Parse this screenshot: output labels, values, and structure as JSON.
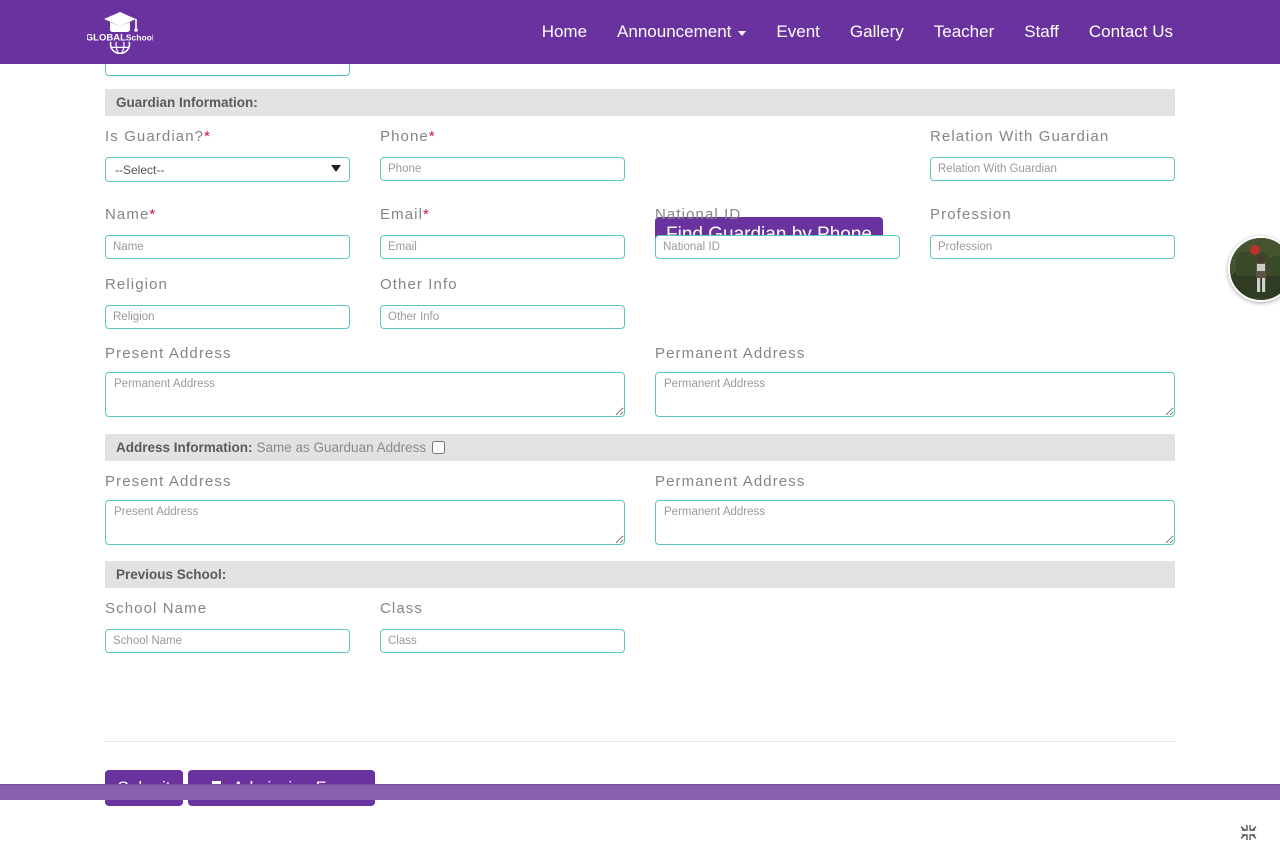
{
  "header": {
    "logo": {
      "icon": "graduation-cap-globe-logo",
      "text_primary": "GLOBAL",
      "text_secondary": "School"
    },
    "nav": [
      {
        "label": "Home",
        "has_dropdown": false
      },
      {
        "label": "Announcement",
        "has_dropdown": true
      },
      {
        "label": "Event",
        "has_dropdown": false
      },
      {
        "label": "Gallery",
        "has_dropdown": false
      },
      {
        "label": "Teacher",
        "has_dropdown": false
      },
      {
        "label": "Staff",
        "has_dropdown": false
      },
      {
        "label": "Contact Us",
        "has_dropdown": false
      }
    ],
    "background_color": "#6a329f"
  },
  "sections": {
    "guardian": {
      "title": "Guardian Information:"
    },
    "address": {
      "title": "Address Information:",
      "subtitle": "Same as Guarduan Address",
      "checkbox_checked": false
    },
    "previous_school": {
      "title": "Previous School:"
    }
  },
  "guardian_fields": {
    "is_guardian": {
      "label": "Is Guardian?",
      "required": true,
      "selected": "--Select--",
      "options": [
        "--Select--"
      ]
    },
    "phone": {
      "label": "Phone",
      "required": true,
      "placeholder": "Phone",
      "value": ""
    },
    "relation": {
      "label": "Relation With Guardian",
      "required": false,
      "placeholder": "Relation With Guardian",
      "value": ""
    },
    "name": {
      "label": "Name",
      "required": true,
      "placeholder": "Name",
      "value": ""
    },
    "email": {
      "label": "Email",
      "required": true,
      "placeholder": "Email",
      "value": ""
    },
    "national_id": {
      "label": "National ID",
      "required": false,
      "placeholder": "National ID",
      "value": ""
    },
    "profession": {
      "label": "Profession",
      "required": false,
      "placeholder": "Profession",
      "value": ""
    },
    "religion": {
      "label": "Religion",
      "required": false,
      "placeholder": "Religion",
      "value": ""
    },
    "other_info": {
      "label": "Other Info",
      "required": false,
      "placeholder": "Other Info",
      "value": ""
    },
    "present_address": {
      "label": "Present Address",
      "placeholder": "Permanent Address",
      "value": ""
    },
    "permanent_address": {
      "label": "Permanent Address",
      "placeholder": "Permanent Address",
      "value": ""
    }
  },
  "address_fields": {
    "present_address": {
      "label": "Present Address",
      "placeholder": "Present Address",
      "value": ""
    },
    "permanent_address": {
      "label": "Permanent Address",
      "placeholder": "Permanent Address",
      "value": ""
    }
  },
  "previous_school_fields": {
    "school_name": {
      "label": "School Name",
      "placeholder": "School Name",
      "value": ""
    },
    "class": {
      "label": "Class",
      "placeholder": "Class",
      "value": ""
    }
  },
  "buttons": {
    "find_guardian": {
      "label": "Find Guardian by Phone"
    },
    "submit": {
      "label": "Submit"
    },
    "admission_form": {
      "label": "Admission Form",
      "icon": "printer-icon"
    }
  },
  "widgets": {
    "avatar": {
      "icon": "user-photo-avatar"
    },
    "fullscreen_exit": {
      "icon": "compress-arrows-icon"
    }
  },
  "colors": {
    "brand_purple": "#6a329f",
    "footer_purple": "#8a5fb0",
    "input_border_teal": "#5bc7c2",
    "required_red": "#d0103a",
    "section_bar_grey": "#e2e2e2",
    "label_grey": "#858585"
  }
}
